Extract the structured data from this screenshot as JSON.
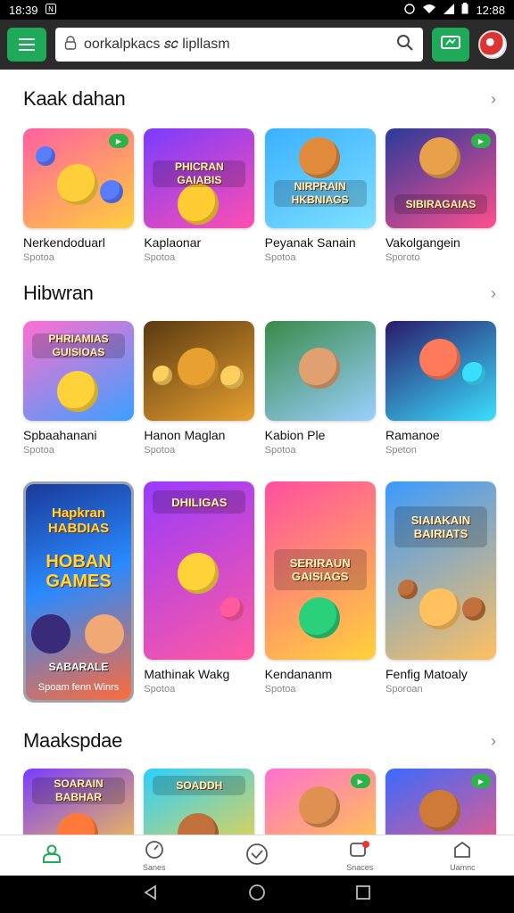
{
  "status": {
    "time_left": "18:39",
    "time_right": "12:88"
  },
  "topbar": {
    "search_value": "oorkalpkacs 𝑠𝑐 lipllasm"
  },
  "sections": [
    {
      "title": "Kaak dahan",
      "items": [
        {
          "title": "Nerkendoduarl",
          "sub": "Spotoa",
          "colors": [
            "#ff5fa2",
            "#ffcf3a"
          ],
          "accent": "#5a7cff"
        },
        {
          "title": "Kaplaonar",
          "sub": "Spotoa",
          "colors": [
            "#7a3cff",
            "#ff4fb0"
          ],
          "accent": "#ffcc33",
          "banner": "PHICRAN GAIABIS"
        },
        {
          "title": "Peyanak Sanain",
          "sub": "Spotoa",
          "colors": [
            "#3ab0ff",
            "#7fe0ff"
          ],
          "accent": "#e08a3c",
          "banner": "NIRPRAIN HKBNIAGS"
        },
        {
          "title": "Vakolgangein",
          "sub": "Sporoto",
          "colors": [
            "#2a3a9a",
            "#ff4f8f"
          ],
          "accent": "#e8a04a",
          "banner": "SIBIRAGAIAS"
        }
      ]
    },
    {
      "title": "Hibwran",
      "items": [
        {
          "title": "Spbaahanani",
          "sub": "Spotoa",
          "colors": [
            "#ff6fd0",
            "#3aa0ff"
          ],
          "accent": "#ffd23a",
          "banner": "PHRIAMIAS GUISIOAS"
        },
        {
          "title": "Hanon Maglan",
          "sub": "Spotoa",
          "colors": [
            "#5a3a10",
            "#e8a030"
          ],
          "accent": "#ffd060"
        },
        {
          "title": "Kabion Ple",
          "sub": "Spotoa",
          "colors": [
            "#3a8a4a",
            "#9ad0ff"
          ],
          "accent": "#e0a070"
        },
        {
          "title": "Ramanoe",
          "sub": "Speton",
          "colors": [
            "#2a1a6a",
            "#3adfff"
          ],
          "accent": "#ff7a5a"
        }
      ]
    },
    {
      "featured": {
        "line1": "Hapkran HABDIAS",
        "line2": "HOBAN GAMES",
        "line3": "SABARALE",
        "line4": "Spoam fenn Winrs"
      },
      "items": [
        {
          "title": "Mathinak Wakg",
          "sub": "Spotoa",
          "colors": [
            "#9a3aff",
            "#ff5aa0"
          ],
          "accent": "#ffd23a",
          "banner": "DHILIGAS"
        },
        {
          "title": "Kendananm",
          "sub": "Spotoa",
          "colors": [
            "#ff4fa0",
            "#ffd23a"
          ],
          "accent": "#2ad07a",
          "banner": "SERIRAUN GAISIAGS"
        },
        {
          "title": "Fenfig Matoaly",
          "sub": "Sporoan",
          "colors": [
            "#3a9aff",
            "#ffc060"
          ],
          "accent": "#c0703a",
          "banner": "SIAIAKAIN BAIRIATS"
        }
      ]
    },
    {
      "title": "Maakspdae",
      "items": [
        {
          "title": "",
          "sub": "",
          "colors": [
            "#7a3cff",
            "#ffcf3a"
          ],
          "accent": "#ff7a3a",
          "banner": "SOARAIN BABHAR"
        },
        {
          "title": "",
          "sub": "",
          "colors": [
            "#2ad0ff",
            "#ffd23a"
          ],
          "accent": "#c0703a",
          "banner": "SOADDH"
        },
        {
          "title": "",
          "sub": "",
          "colors": [
            "#ff6fd0",
            "#ffd23a"
          ],
          "accent": "#e09050"
        },
        {
          "title": "",
          "sub": "",
          "colors": [
            "#3a6aff",
            "#ff5a7a"
          ],
          "accent": "#d07a3a"
        }
      ]
    }
  ],
  "bottom_nav": [
    {
      "label": "",
      "icon": "home-icon"
    },
    {
      "label": "Sanes",
      "icon": "compass-icon"
    },
    {
      "label": "",
      "icon": "clock-icon"
    },
    {
      "label": "Snaces",
      "icon": "chat-icon"
    },
    {
      "label": "Uamnc",
      "icon": "shop-icon"
    }
  ]
}
